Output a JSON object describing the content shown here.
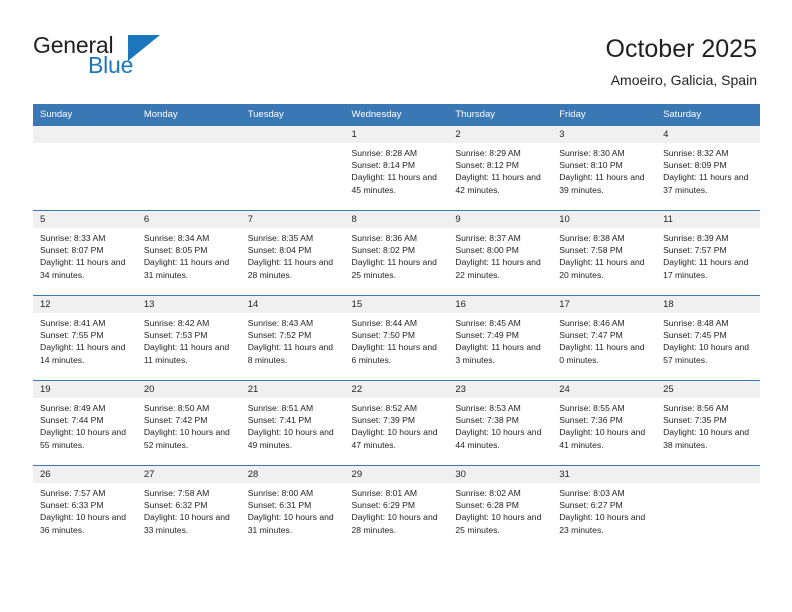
{
  "brand": {
    "name_top": "General",
    "name_bottom": "Blue",
    "triangle_color": "#1c76bc"
  },
  "header": {
    "title": "October 2025",
    "subtitle": "Amoeiro, Galicia, Spain"
  },
  "theme": {
    "header_blue": "#3a77b5",
    "band_gray": "#f0f0f0",
    "text": "#231f20"
  },
  "weekday_headers": [
    "Sunday",
    "Monday",
    "Tuesday",
    "Wednesday",
    "Thursday",
    "Friday",
    "Saturday"
  ],
  "labels": {
    "sunrise_prefix": "Sunrise: ",
    "sunset_prefix": "Sunset: ",
    "daylight_prefix": "Daylight: "
  },
  "weeks": [
    [
      {
        "day": "",
        "empty": true
      },
      {
        "day": "",
        "empty": true
      },
      {
        "day": "",
        "empty": true
      },
      {
        "day": "1",
        "sunrise": "Sunrise: 8:28 AM",
        "sunset": "Sunset: 8:14 PM",
        "daylight": "Daylight: 11 hours and 45 minutes."
      },
      {
        "day": "2",
        "sunrise": "Sunrise: 8:29 AM",
        "sunset": "Sunset: 8:12 PM",
        "daylight": "Daylight: 11 hours and 42 minutes."
      },
      {
        "day": "3",
        "sunrise": "Sunrise: 8:30 AM",
        "sunset": "Sunset: 8:10 PM",
        "daylight": "Daylight: 11 hours and 39 minutes."
      },
      {
        "day": "4",
        "sunrise": "Sunrise: 8:32 AM",
        "sunset": "Sunset: 8:09 PM",
        "daylight": "Daylight: 11 hours and 37 minutes."
      }
    ],
    [
      {
        "day": "5",
        "sunrise": "Sunrise: 8:33 AM",
        "sunset": "Sunset: 8:07 PM",
        "daylight": "Daylight: 11 hours and 34 minutes."
      },
      {
        "day": "6",
        "sunrise": "Sunrise: 8:34 AM",
        "sunset": "Sunset: 8:05 PM",
        "daylight": "Daylight: 11 hours and 31 minutes."
      },
      {
        "day": "7",
        "sunrise": "Sunrise: 8:35 AM",
        "sunset": "Sunset: 8:04 PM",
        "daylight": "Daylight: 11 hours and 28 minutes."
      },
      {
        "day": "8",
        "sunrise": "Sunrise: 8:36 AM",
        "sunset": "Sunset: 8:02 PM",
        "daylight": "Daylight: 11 hours and 25 minutes."
      },
      {
        "day": "9",
        "sunrise": "Sunrise: 8:37 AM",
        "sunset": "Sunset: 8:00 PM",
        "daylight": "Daylight: 11 hours and 22 minutes."
      },
      {
        "day": "10",
        "sunrise": "Sunrise: 8:38 AM",
        "sunset": "Sunset: 7:58 PM",
        "daylight": "Daylight: 11 hours and 20 minutes."
      },
      {
        "day": "11",
        "sunrise": "Sunrise: 8:39 AM",
        "sunset": "Sunset: 7:57 PM",
        "daylight": "Daylight: 11 hours and 17 minutes."
      }
    ],
    [
      {
        "day": "12",
        "sunrise": "Sunrise: 8:41 AM",
        "sunset": "Sunset: 7:55 PM",
        "daylight": "Daylight: 11 hours and 14 minutes."
      },
      {
        "day": "13",
        "sunrise": "Sunrise: 8:42 AM",
        "sunset": "Sunset: 7:53 PM",
        "daylight": "Daylight: 11 hours and 11 minutes."
      },
      {
        "day": "14",
        "sunrise": "Sunrise: 8:43 AM",
        "sunset": "Sunset: 7:52 PM",
        "daylight": "Daylight: 11 hours and 8 minutes."
      },
      {
        "day": "15",
        "sunrise": "Sunrise: 8:44 AM",
        "sunset": "Sunset: 7:50 PM",
        "daylight": "Daylight: 11 hours and 6 minutes."
      },
      {
        "day": "16",
        "sunrise": "Sunrise: 8:45 AM",
        "sunset": "Sunset: 7:49 PM",
        "daylight": "Daylight: 11 hours and 3 minutes."
      },
      {
        "day": "17",
        "sunrise": "Sunrise: 8:46 AM",
        "sunset": "Sunset: 7:47 PM",
        "daylight": "Daylight: 11 hours and 0 minutes."
      },
      {
        "day": "18",
        "sunrise": "Sunrise: 8:48 AM",
        "sunset": "Sunset: 7:45 PM",
        "daylight": "Daylight: 10 hours and 57 minutes."
      }
    ],
    [
      {
        "day": "19",
        "sunrise": "Sunrise: 8:49 AM",
        "sunset": "Sunset: 7:44 PM",
        "daylight": "Daylight: 10 hours and 55 minutes."
      },
      {
        "day": "20",
        "sunrise": "Sunrise: 8:50 AM",
        "sunset": "Sunset: 7:42 PM",
        "daylight": "Daylight: 10 hours and 52 minutes."
      },
      {
        "day": "21",
        "sunrise": "Sunrise: 8:51 AM",
        "sunset": "Sunset: 7:41 PM",
        "daylight": "Daylight: 10 hours and 49 minutes."
      },
      {
        "day": "22",
        "sunrise": "Sunrise: 8:52 AM",
        "sunset": "Sunset: 7:39 PM",
        "daylight": "Daylight: 10 hours and 47 minutes."
      },
      {
        "day": "23",
        "sunrise": "Sunrise: 8:53 AM",
        "sunset": "Sunset: 7:38 PM",
        "daylight": "Daylight: 10 hours and 44 minutes."
      },
      {
        "day": "24",
        "sunrise": "Sunrise: 8:55 AM",
        "sunset": "Sunset: 7:36 PM",
        "daylight": "Daylight: 10 hours and 41 minutes."
      },
      {
        "day": "25",
        "sunrise": "Sunrise: 8:56 AM",
        "sunset": "Sunset: 7:35 PM",
        "daylight": "Daylight: 10 hours and 38 minutes."
      }
    ],
    [
      {
        "day": "26",
        "sunrise": "Sunrise: 7:57 AM",
        "sunset": "Sunset: 6:33 PM",
        "daylight": "Daylight: 10 hours and 36 minutes."
      },
      {
        "day": "27",
        "sunrise": "Sunrise: 7:58 AM",
        "sunset": "Sunset: 6:32 PM",
        "daylight": "Daylight: 10 hours and 33 minutes."
      },
      {
        "day": "28",
        "sunrise": "Sunrise: 8:00 AM",
        "sunset": "Sunset: 6:31 PM",
        "daylight": "Daylight: 10 hours and 31 minutes."
      },
      {
        "day": "29",
        "sunrise": "Sunrise: 8:01 AM",
        "sunset": "Sunset: 6:29 PM",
        "daylight": "Daylight: 10 hours and 28 minutes."
      },
      {
        "day": "30",
        "sunrise": "Sunrise: 8:02 AM",
        "sunset": "Sunset: 6:28 PM",
        "daylight": "Daylight: 10 hours and 25 minutes."
      },
      {
        "day": "31",
        "sunrise": "Sunrise: 8:03 AM",
        "sunset": "Sunset: 6:27 PM",
        "daylight": "Daylight: 10 hours and 23 minutes."
      },
      {
        "day": "",
        "empty": true
      }
    ]
  ]
}
